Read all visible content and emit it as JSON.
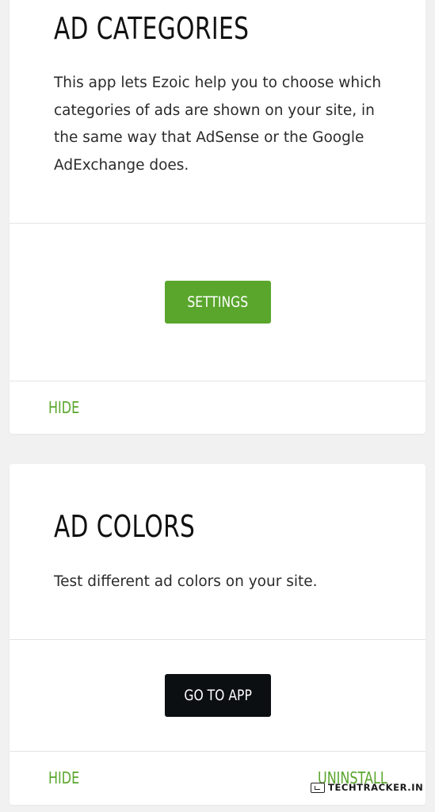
{
  "apps": [
    {
      "title": "AD CATEGORIES",
      "description": "This app lets Ezoic help you to choose which categories of ads are shown on your site, in the same way that AdSense or the Google AdExchange does.",
      "action_label": "SETTINGS",
      "hide_label": "HIDE"
    },
    {
      "title": "AD COLORS",
      "description": "Test different ad colors on your site.",
      "action_label": "GO TO APP",
      "hide_label": "HIDE",
      "uninstall_label": "UNINSTALL"
    }
  ],
  "watermark": {
    "text": "TECHTRACKER.IN",
    "icon": "browser-check-icon"
  },
  "colors": {
    "accent_green": "#5aa62d",
    "dark_button": "#0b0f12",
    "page_background": "#f1f1f1"
  }
}
